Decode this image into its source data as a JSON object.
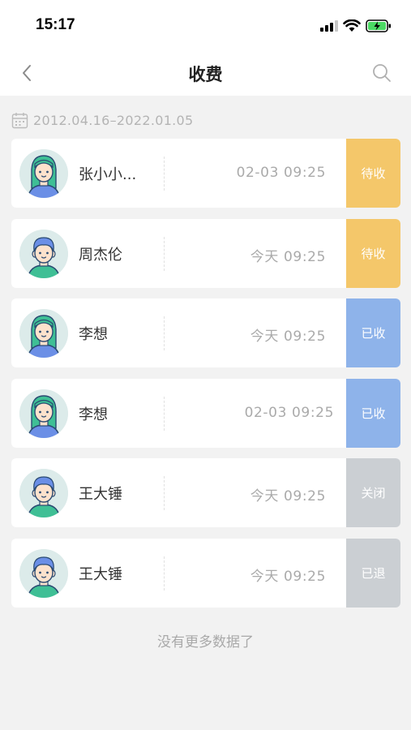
{
  "status_bar": {
    "time": "15:17"
  },
  "nav": {
    "title": "收费",
    "back_icon": "chevron-left-icon",
    "search_icon": "search-icon"
  },
  "date_range": "2012.04.16–2022.01.05",
  "colors": {
    "pending": "#f4c76a",
    "received": "#8eb3ea",
    "closed": "#cbcfd3",
    "refunded": "#cbcfd3"
  },
  "records": [
    {
      "name": "张小小...",
      "time": "02-03 09:25",
      "status": "待收",
      "avatar": "girl"
    },
    {
      "name": "周杰伦",
      "time": "今天 09:25",
      "status": "待收",
      "avatar": "boy"
    },
    {
      "name": "李想",
      "time": "今天 09:25",
      "status": "已收",
      "avatar": "girl"
    },
    {
      "name": "李想",
      "time": "02-03 09:25",
      "status": "已收",
      "avatar": "girl"
    },
    {
      "name": "王大锤",
      "time": "今天 09:25",
      "status": "关闭",
      "avatar": "boy"
    },
    {
      "name": "王大锤",
      "time": "今天 09:25",
      "status": "已退",
      "avatar": "boy"
    }
  ],
  "footer": "没有更多数据了"
}
